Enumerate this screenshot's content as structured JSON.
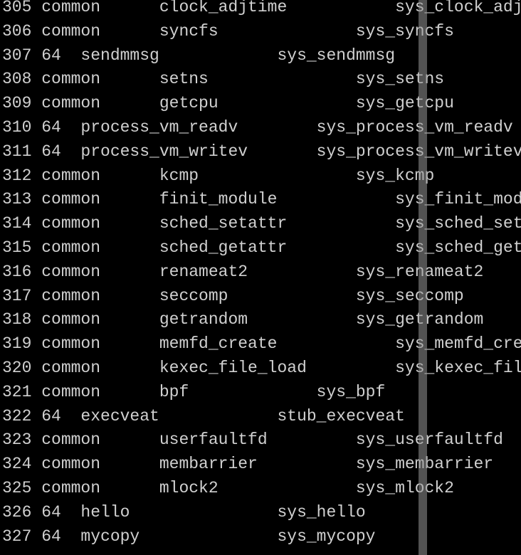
{
  "rows": [
    {
      "num": "305",
      "abi": "common",
      "name": "clock_adjtime",
      "entry": "sys_clock_adjtime",
      "indent1": 2,
      "indent2": 3
    },
    {
      "num": "306",
      "abi": "common",
      "name": "syncfs",
      "entry": "sys_syncfs",
      "indent1": 2,
      "indent2": 4
    },
    {
      "num": "307",
      "abi": "64",
      "name": "sendmmsg",
      "entry": "sys_sendmmsg",
      "indent1": 1,
      "indent2": 3
    },
    {
      "num": "308",
      "abi": "common",
      "name": "setns",
      "entry": "sys_setns",
      "indent1": 2,
      "indent2": 4
    },
    {
      "num": "309",
      "abi": "common",
      "name": "getcpu",
      "entry": "sys_getcpu",
      "indent1": 2,
      "indent2": 4
    },
    {
      "num": "310",
      "abi": "64",
      "name": "process_vm_readv",
      "entry": "sys_process_vm_readv",
      "indent1": 1,
      "indent2": 2
    },
    {
      "num": "311",
      "abi": "64",
      "name": "process_vm_writev",
      "entry": "sys_process_vm_writev",
      "indent1": 1,
      "indent2": 2
    },
    {
      "num": "312",
      "abi": "common",
      "name": "kcmp",
      "entry": "sys_kcmp",
      "indent1": 2,
      "indent2": 4
    },
    {
      "num": "313",
      "abi": "common",
      "name": "finit_module",
      "entry": "sys_finit_module",
      "indent1": 2,
      "indent2": 3
    },
    {
      "num": "314",
      "abi": "common",
      "name": "sched_setattr",
      "entry": "sys_sched_setattr",
      "indent1": 2,
      "indent2": 3
    },
    {
      "num": "315",
      "abi": "common",
      "name": "sched_getattr",
      "entry": "sys_sched_getattr",
      "indent1": 2,
      "indent2": 3
    },
    {
      "num": "316",
      "abi": "common",
      "name": "renameat2",
      "entry": "sys_renameat2",
      "indent1": 2,
      "indent2": 3
    },
    {
      "num": "317",
      "abi": "common",
      "name": "seccomp",
      "entry": "sys_seccomp",
      "indent1": 2,
      "indent2": 4
    },
    {
      "num": "318",
      "abi": "common",
      "name": "getrandom",
      "entry": "sys_getrandom",
      "indent1": 2,
      "indent2": 3
    },
    {
      "num": "319",
      "abi": "common",
      "name": "memfd_create",
      "entry": "sys_memfd_create",
      "indent1": 2,
      "indent2": 3
    },
    {
      "num": "320",
      "abi": "common",
      "name": "kexec_file_load",
      "entry": "sys_kexec_file_load",
      "indent1": 2,
      "indent2": 3
    },
    {
      "num": "321",
      "abi": "common",
      "name": "bpf",
      "entry": "sys_bpf",
      "indent1": 2,
      "indent2": 4
    },
    {
      "num": "322",
      "abi": "64",
      "name": "execveat",
      "entry": "stub_execveat",
      "indent1": 1,
      "indent2": 3
    },
    {
      "num": "323",
      "abi": "common",
      "name": "userfaultfd",
      "entry": "sys_userfaultfd",
      "indent1": 2,
      "indent2": 3
    },
    {
      "num": "324",
      "abi": "common",
      "name": "membarrier",
      "entry": "sys_membarrier",
      "indent1": 2,
      "indent2": 3
    },
    {
      "num": "325",
      "abi": "common",
      "name": "mlock2",
      "entry": "sys_mlock2",
      "indent1": 2,
      "indent2": 4
    },
    {
      "num": "326",
      "abi": "64",
      "name": "hello",
      "entry": "sys_hello",
      "indent1": 1,
      "indent2": 4
    },
    {
      "num": "327",
      "abi": "64",
      "name": "mycopy",
      "entry": "sys_mycopy",
      "indent1": 1,
      "indent2": 4
    }
  ]
}
